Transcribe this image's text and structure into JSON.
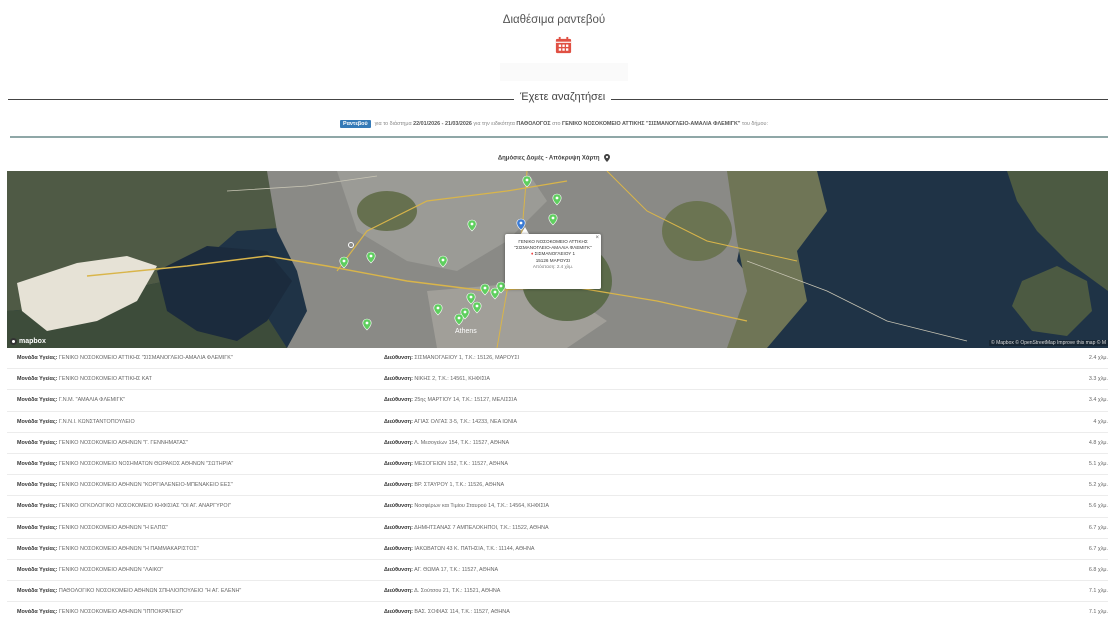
{
  "header": {
    "title": "Διαθέσιμα ραντεβού"
  },
  "section": {
    "title": "Έχετε αναζητήσει"
  },
  "search": {
    "badge": "Ραντεβού",
    "text_1": "για το διάστημα",
    "date_range": "22/01/2026 - 21/03/2026",
    "text_2": "για την ειδικότητα",
    "specialty": "ΠΑΘΟΛΟΓΟΣ",
    "text_3": "στο",
    "hospital": "ΓΕΝΙΚΟ ΝΟΣΟΚΟΜΕΙΟ ΑΤΤΙΚΗΣ \"ΣΙΣΜΑΝΟΓΛΕΙΟ-ΑΜΑΛΙΑ ΦΛΕΜΙΓΚ\"",
    "text_4": "του δήμου:"
  },
  "map_section": {
    "heading": "Δημόσιες Δομές - Απόκρυψη Χάρτη",
    "popup": {
      "name_line1": "ΓΕΝΙΚΟ ΝΟΣΟΚΟΜΕΙΟ ΑΤΤΙΚΗΣ",
      "name_line2": "\"ΣΙΣΜΑΝΟΓΛΕΙΟ-ΑΜΑΛΙΑ ΦΛΕΜΙΓΚ\"",
      "street": "ΣΙΣΜΑΝΟΓΛΕΙΟΥ 1",
      "postcode": "15126 ΜΑΡΟΥΣΙ",
      "distance": "Απόσταση: 2.4 χλμ.",
      "close": "×"
    },
    "city_label": "Athens",
    "mapbox": "mapbox",
    "attribution": "© Mapbox © OpenStreetMap Improve this map © M"
  },
  "labels": {
    "unit": "Μονάδα Υγείας:",
    "address": "Διεύθυνση:"
  },
  "units": [
    {
      "name": "ΓΕΝΙΚΟ ΝΟΣΟΚΟΜΕΙΟ ΑΤΤΙΚΗΣ \"ΣΙΣΜΑΝΟΓΛΕΙΟ-ΑΜΑΛΙΑ ΦΛΕΜΙΓΚ\"",
      "address": "ΣΙΣΜΑΝΟΓΛΕΙΟΥ 1, Τ.Κ.: 15126, ΜΑΡΟΥΣΙ",
      "distance": "2.4 χλμ."
    },
    {
      "name": "ΓΕΝΙΚΟ ΝΟΣΟΚΟΜΕΙΟ ΑΤΤΙΚΗΣ ΚΑΤ",
      "address": "ΝΙΚΗΣ 2, Τ.Κ.: 14561, ΚΗΦΙΣΙΑ",
      "distance": "3.3 χλμ."
    },
    {
      "name": "Γ.Ν.Μ. \"ΑΜΑΛΙΑ ΦΛΕΜΙΓΚ\"",
      "address": "25ης ΜΑΡΤΙΟΥ 14, Τ.Κ.: 15127, ΜΕΛΙΣΣΙΑ",
      "distance": "3.4 χλμ."
    },
    {
      "name": "Γ.Ν.Ν.Ι. ΚΩΝΣΤΑΝΤΟΠΟΥΛΕΙΟ",
      "address": "ΑΓΙΑΣ ΟΛΓΑΣ 3-5, Τ.Κ.: 14233, ΝΕΑ ΙΩΝΙΑ",
      "distance": "4 χλμ."
    },
    {
      "name": "ΓΕΝΙΚΟ ΝΟΣΟΚΟΜΕΙΟ ΑΘΗΝΩΝ \"Γ. ΓΕΝΝΗΜΑΤΑΣ\"",
      "address": "Λ. Μεσογείων 154, Τ.Κ.: 11527, ΑΘΗΝΑ",
      "distance": "4.8 χλμ."
    },
    {
      "name": "ΓΕΝΙΚΟ ΝΟΣΟΚΟΜΕΙΟ ΝΟΣΗΜΑΤΩΝ ΘΩΡΑΚΟΣ ΑΘΗΝΩΝ \"ΣΩΤΗΡΙΑ\"",
      "address": "ΜΕΣΟΓΕΙΩΝ 152, Τ.Κ.: 11527, ΑΘΗΝΑ",
      "distance": "5.1 χλμ."
    },
    {
      "name": "ΓΕΝΙΚΟ ΝΟΣΟΚΟΜΕΙΟ ΑΘΗΝΩΝ \"ΚΟΡΓΙΑΛΕΝΕΙΟ-ΜΠΕΝΑΚΕΙΟ ΕΕΣ\"",
      "address": "ΒΡ. ΣΤΑΥΡΟΥ 1, Τ.Κ.: 11526, ΑΘΗΝΑ",
      "distance": "5.2 χλμ."
    },
    {
      "name": "ΓΕΝΙΚΟ ΟΓΚΟΛΟΓΙΚΟ ΝΟΣΟΚΟΜΕΙΟ ΚΗΦΙΣΙΑΣ \"ΟΙ ΑΓ. ΑΝΑΡΓΥΡΟΙ\"",
      "address": "Νοσφέρων και Τιμίου Σταυρού 14, Τ.Κ.: 14564, ΚΗΦΙΣΙΑ",
      "distance": "5.6 χλμ."
    },
    {
      "name": "ΓΕΝΙΚΟ ΝΟΣΟΚΟΜΕΙΟ ΑΘΗΝΩΝ \"Η ΕΛΠΙΣ\"",
      "address": "ΔΗΜΗΤΣΑΝΑΣ 7 ΑΜΠΕΛΟΚΗΠΟΙ, Τ.Κ.: 11522, ΑΘΗΝΑ",
      "distance": "6.7 χλμ."
    },
    {
      "name": "ΓΕΝΙΚΟ ΝΟΣΟΚΟΜΕΙΟ ΑΘΗΝΩΝ \"Η ΠΑΜΜΑΚΑΡΙΣΤΟΣ\"",
      "address": "ΙΑΚΩΒΑΤΩΝ 43 Κ. ΠΑΤΗΣΙΑ, Τ.Κ.: 11144, ΑΘΗΝΑ",
      "distance": "6.7 χλμ."
    },
    {
      "name": "ΓΕΝΙΚΟ ΝΟΣΟΚΟΜΕΙΟ ΑΘΗΝΩΝ \"ΛΑΙΚΟ\"",
      "address": "ΑΓ. ΘΩΜΑ 17, Τ.Κ.: 11527, ΑΘΗΝΑ",
      "distance": "6.8 χλμ."
    },
    {
      "name": "ΠΑΘΟΛΟΓΙΚΟ ΝΟΣΟΚΟΜΕΙΟ ΑΘΗΝΩΝ ΣΠΗΛΙΟΠΟΥΛΕΙΟ \"Η ΑΓ. ΕΛΕΝΗ\"",
      "address": "Δ. Σούτσου 21, Τ.Κ.: 11521, ΑΘΗΝΑ",
      "distance": "7.1 χλμ."
    },
    {
      "name": "ΓΕΝΙΚΟ ΝΟΣΟΚΟΜΕΙΟ ΑΘΗΝΩΝ \"ΙΠΠΟΚΡΑΤΕΙΟ\"",
      "address": "ΒΑΣ. ΣΟΦΙΑΣ 114, Τ.Κ.: 11527, ΑΘΗΝΑ",
      "distance": "7.1 χλμ."
    }
  ],
  "colors": {
    "badge": "#357ab7",
    "calendar_icon": "#e05043",
    "marker": "#5fcf5f",
    "marker_selected": "#3a7bd5",
    "rule_teal": "#8fa7a7"
  }
}
